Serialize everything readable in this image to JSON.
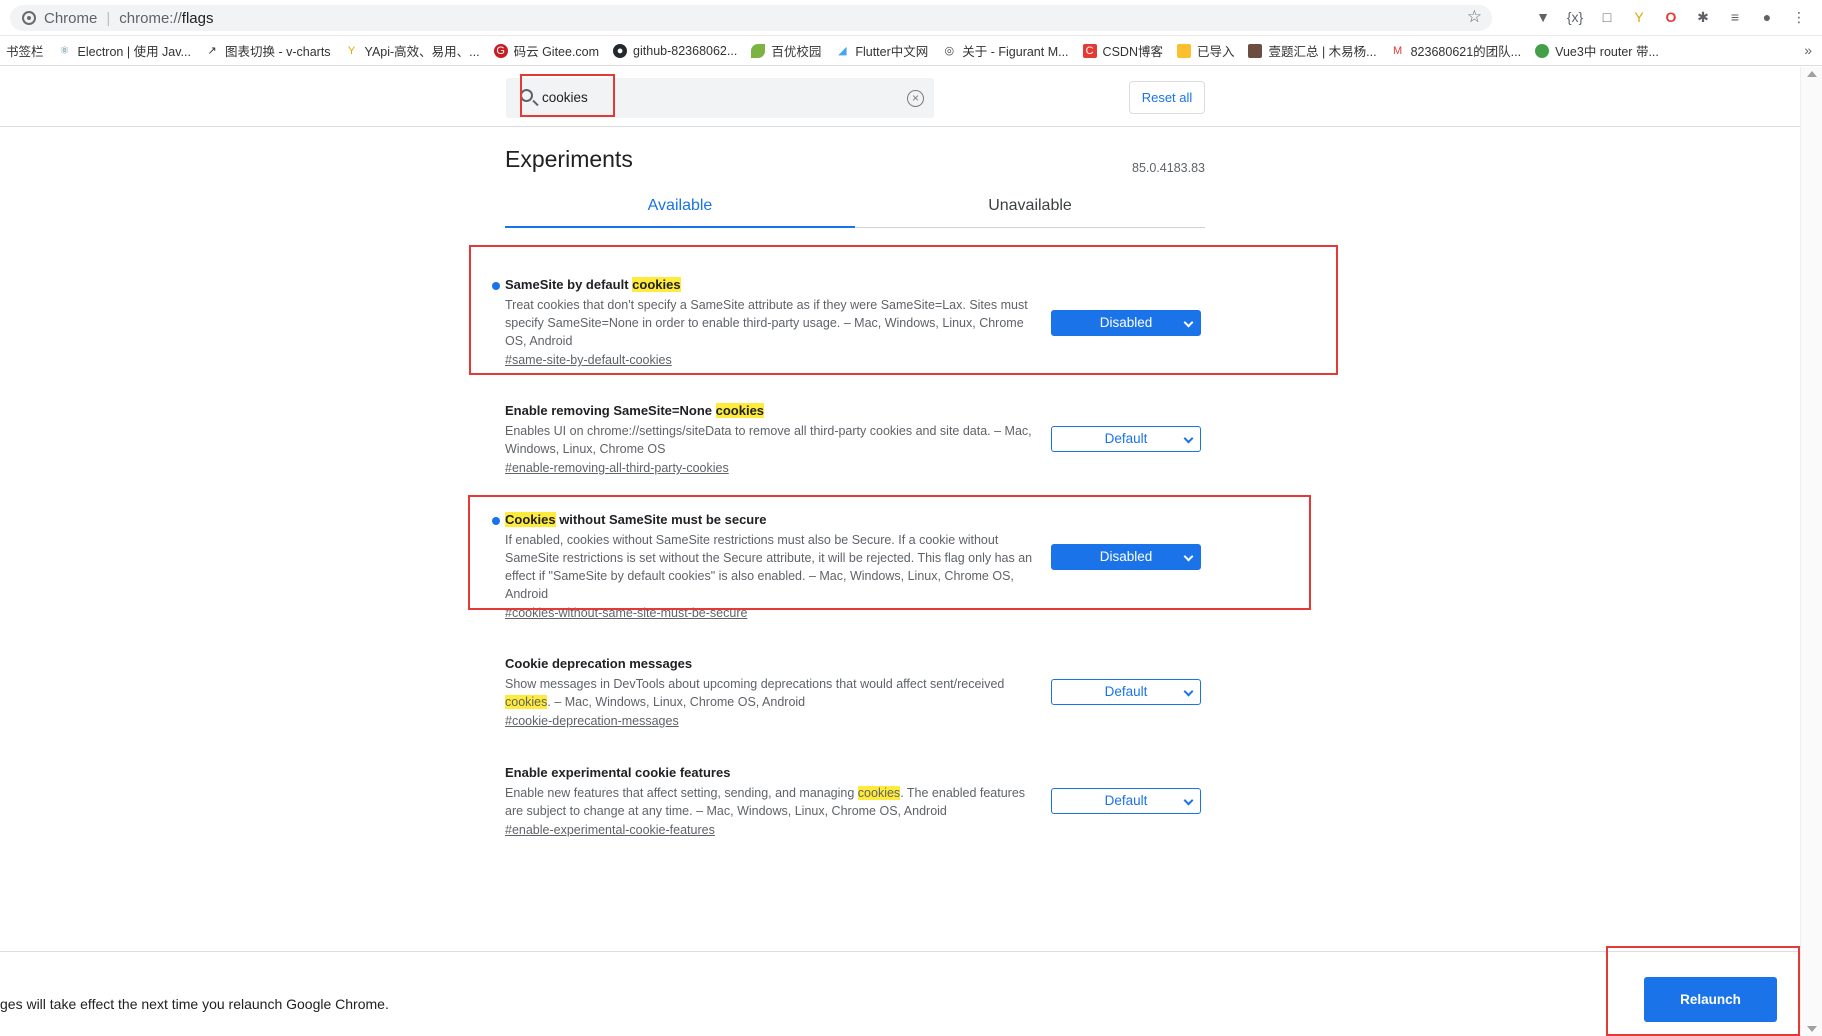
{
  "browser": {
    "site_label": "Chrome",
    "url_scheme": "chrome://",
    "url_host": "flags",
    "star_icon": "star-icon"
  },
  "bookmarks": [
    {
      "label": "书签栏",
      "icon": "none"
    },
    {
      "label": "Electron | 使用 Jav...",
      "icon": "electron-icon"
    },
    {
      "label": "图表切换 - v-charts",
      "icon": "chart-icon"
    },
    {
      "label": "YApi-高效、易用、...",
      "icon": "yapi-icon"
    },
    {
      "label": "码云 Gitee.com",
      "icon": "gitee-icon"
    },
    {
      "label": "github-82368062...",
      "icon": "github-icon"
    },
    {
      "label": "百优校园",
      "icon": "leaf-icon"
    },
    {
      "label": "Flutter中文网",
      "icon": "flutter-icon"
    },
    {
      "label": "关于 - Figurant M...",
      "icon": "globe-icon"
    },
    {
      "label": "CSDN博客",
      "icon": "csdn-icon"
    },
    {
      "label": "已导入",
      "icon": "folder-icon"
    },
    {
      "label": "壹题汇总 | 木易杨...",
      "icon": "avatar-icon"
    },
    {
      "label": "823680621的团队...",
      "icon": "mail-icon"
    },
    {
      "label": "Vue3中 router 带...",
      "icon": "wechat-icon"
    }
  ],
  "bookmarks_more": "»",
  "search": {
    "value": "cookies",
    "clear_symbol": "×"
  },
  "reset_label": "Reset all",
  "title": "Experiments",
  "version": "85.0.4183.83",
  "tabs": {
    "available": "Available",
    "unavailable": "Unavailable"
  },
  "experiments": [
    {
      "name_pre": "SameSite by default ",
      "name_hl": "cookies",
      "name_post": "",
      "modified": true,
      "desc_pre": "Treat cookies that don't specify a SameSite attribute as if they were SameSite=Lax. Sites must specify SameSite=None in order to enable third-party usage. – Mac, Windows, Linux, Chrome OS, Android",
      "desc_hl": "",
      "desc_post": "",
      "link": "#same-site-by-default-cookies",
      "value": "Disabled"
    },
    {
      "name_pre": "Enable removing SameSite=None ",
      "name_hl": "cookies",
      "name_post": "",
      "modified": false,
      "desc_pre": "Enables UI on chrome://settings/siteData to remove all third-party cookies and site data. – Mac, Windows, Linux, Chrome OS",
      "desc_hl": "",
      "desc_post": "",
      "link": "#enable-removing-all-third-party-cookies",
      "value": "Default"
    },
    {
      "name_pre": "",
      "name_hl": "Cookies",
      "name_post": " without SameSite must be secure",
      "modified": true,
      "desc_pre": "If enabled, cookies without SameSite restrictions must also be Secure. If a cookie without SameSite restrictions is set without the Secure attribute, it will be rejected. This flag only has an effect if \"SameSite by default cookies\" is also enabled. – Mac, Windows, Linux, Chrome OS, Android",
      "desc_hl": "",
      "desc_post": "",
      "link": "#cookies-without-same-site-must-be-secure",
      "value": "Disabled"
    },
    {
      "name_pre": "Cookie deprecation messages",
      "name_hl": "",
      "name_post": "",
      "modified": false,
      "desc_pre": "Show messages in DevTools about upcoming deprecations that would affect sent/received ",
      "desc_hl": "cookies",
      "desc_post": ". – Mac, Windows, Linux, Chrome OS, Android",
      "link": "#cookie-deprecation-messages",
      "value": "Default"
    },
    {
      "name_pre": "Enable experimental cookie features",
      "name_hl": "",
      "name_post": "",
      "modified": false,
      "desc_pre": "Enable new features that affect setting, sending, and managing ",
      "desc_hl": "cookies",
      "desc_post": ". The enabled features are subject to change at any time. – Mac, Windows, Linux, Chrome OS, Android",
      "link": "#enable-experimental-cookie-features",
      "value": "Default"
    }
  ],
  "footer": {
    "message": "ges will take effect the next time you relaunch Google Chrome.",
    "relaunch_label": "Relaunch"
  },
  "colors": {
    "accent": "#1a73e8",
    "highlight": "#ffeb3b",
    "annotation": "#e53935"
  }
}
